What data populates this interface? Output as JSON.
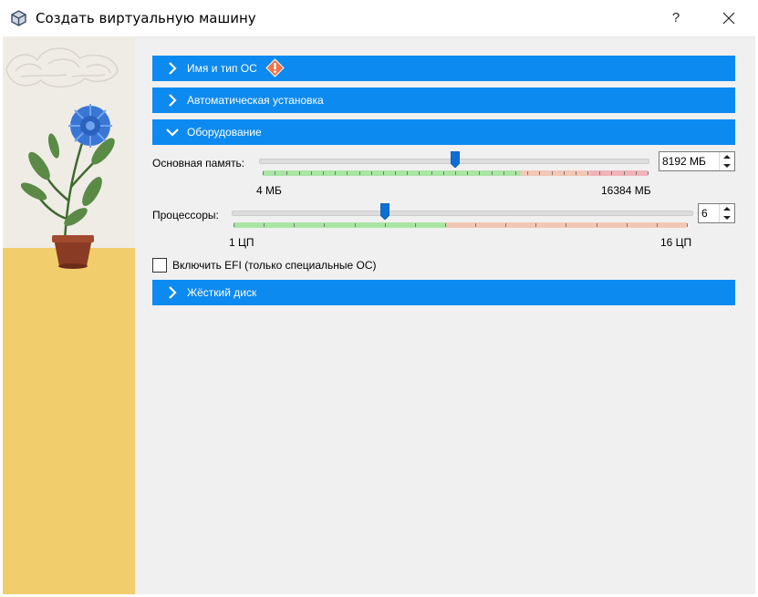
{
  "window": {
    "title": "Создать виртуальную машину",
    "help_label": "?",
    "close_icon": "close-icon",
    "app_icon": "virtualbox-icon"
  },
  "sections": {
    "name_os": {
      "label": "Имя и тип ОС",
      "expanded": false,
      "has_warning": true
    },
    "unattended": {
      "label": "Автоматическая установка",
      "expanded": false
    },
    "hardware": {
      "label": "Оборудование",
      "expanded": true
    },
    "disk": {
      "label": "Жёсткий диск",
      "expanded": false
    }
  },
  "hardware": {
    "memory": {
      "label": "Основная память:",
      "value_text": "8192 МБ",
      "min_label": "4 МБ",
      "max_label": "16384 МБ",
      "value": 8192,
      "min": 4,
      "max": 16384,
      "recommended_fraction": 0.67,
      "warning_fraction": 0.85
    },
    "cpu": {
      "label": "Процессоры:",
      "value_text": "6",
      "min_label": "1 ЦП",
      "max_label": "16 ЦП",
      "value": 6,
      "min": 1,
      "max": 16,
      "recommended_fraction": 0.47
    },
    "efi": {
      "label": "Включить EFI (только специальные ОС)",
      "checked": false
    }
  },
  "colors": {
    "accent": "#0d8aef",
    "scale_green": "#a9e5a3",
    "scale_orange": "#f3c7b5",
    "scale_red": "#f0b3b8",
    "sidebar_wall": "#efece6",
    "sidebar_floor": "#f2cd6b"
  }
}
